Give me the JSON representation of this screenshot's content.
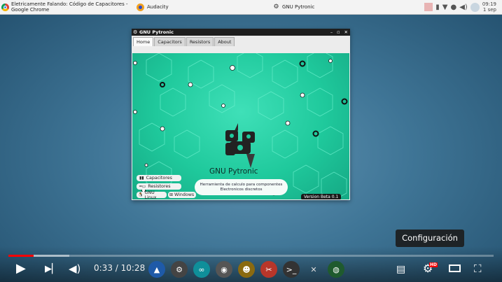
{
  "topbar": {
    "chrome_title": "Eletricamente Falando: Código de Capacitores - Google Chrome",
    "audacity": "Audacity",
    "pytronic": "GNU Pytronic",
    "clock_time": "09:19",
    "clock_date": "1 sep"
  },
  "window": {
    "title": "GNU Pytronic",
    "tabs": [
      "Home",
      "Capacitors",
      "Resistors",
      "About"
    ],
    "app_name": "GNU Pytronic",
    "subtitle_line1": "Herramienta de calculo para componentes",
    "subtitle_line2": "Electronicos discretos",
    "buttons": {
      "capacitors": "Capacitores",
      "resistors": "Resistores",
      "gnu_linux": "GNU Linux",
      "windows": "Windows"
    },
    "version": "Version Beta 0.1"
  },
  "player": {
    "time": "0:33 / 10:28",
    "tooltip": "Configuración",
    "progress_fraction": 0.0525,
    "buffer_fraction": 0.125,
    "played_color": "#ff0000"
  },
  "icons": [
    "chrome-icon",
    "audacity-icon",
    "pytronic-icon",
    "battery-icon",
    "wifi-icon",
    "volume-icon",
    "play-icon",
    "next-icon",
    "volume-icon",
    "subtitles-icon",
    "settings-icon",
    "theater-icon",
    "fullscreen-icon"
  ]
}
